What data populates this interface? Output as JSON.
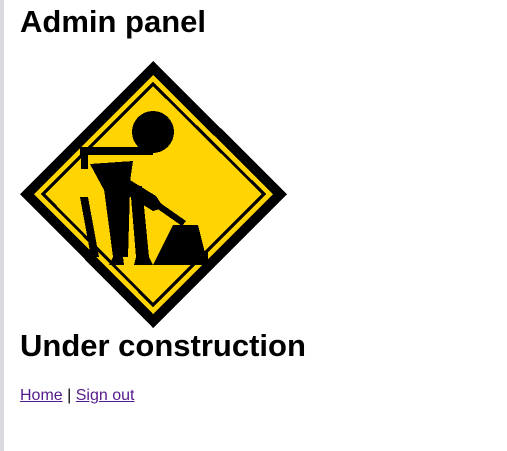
{
  "page": {
    "title": "Admin panel",
    "status_heading": "Under construction"
  },
  "sign": {
    "icon": "under-construction-worker-sign",
    "background_color": "#ffd400",
    "border_color": "#000000"
  },
  "nav": {
    "home_label": "Home",
    "separator": "|",
    "signout_label": "Sign out",
    "link_color": "#551a8b"
  }
}
